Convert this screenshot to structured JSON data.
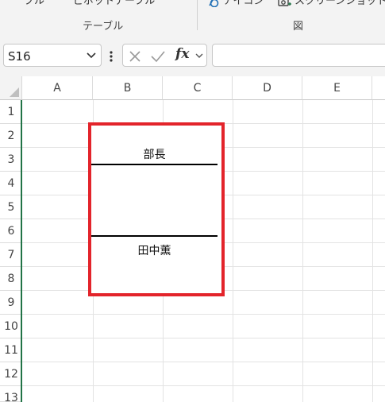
{
  "ribbon": {
    "cut_items": [
      "ブル",
      "ピボットテーブル",
      "アイコン",
      "スクリーンショット"
    ],
    "group_left_label": "テーブル",
    "group_right_label": "図",
    "icons": {
      "icon_item": "shapes-icon",
      "screenshot_item": "camera-icon"
    }
  },
  "formula_bar": {
    "name_box": "S16",
    "fx_label": "fx",
    "formula_value": ""
  },
  "columns": [
    "A",
    "B",
    "C",
    "D",
    "E"
  ],
  "rows": [
    "1",
    "2",
    "3",
    "4",
    "5",
    "6",
    "7",
    "8",
    "9",
    "10",
    "11",
    "12",
    "13"
  ],
  "shape": {
    "title": "部長",
    "name": "田中薫",
    "border_color": "#e3242b"
  },
  "colors": {
    "row_header_accent": "#217346",
    "toolbar_bg": "#f3f3f3"
  }
}
